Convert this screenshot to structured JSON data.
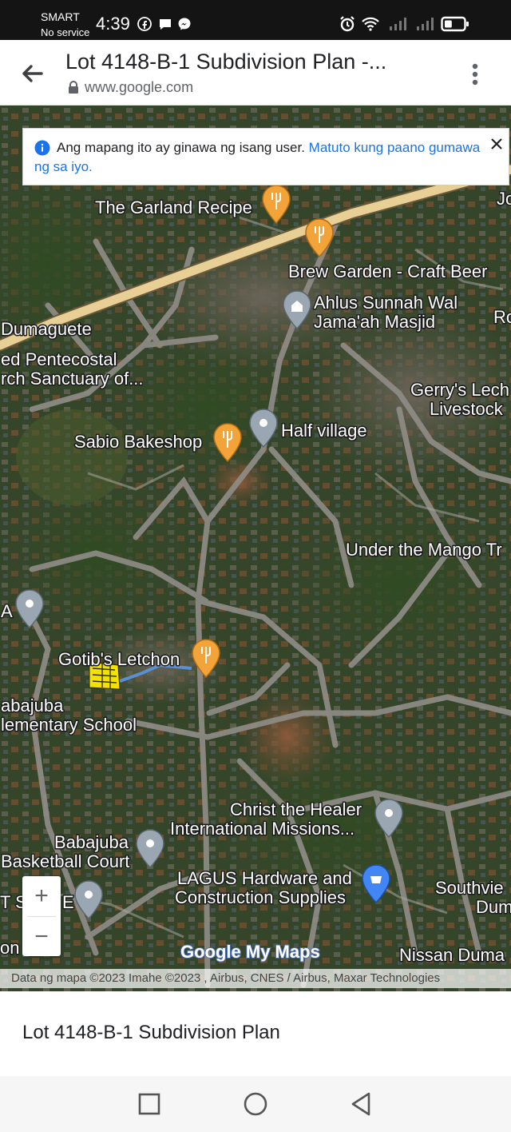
{
  "status_bar": {
    "carrier": "SMART",
    "service": "No service",
    "time": "4:39",
    "battery_level": 0.4
  },
  "header": {
    "title": "Lot 4148-B-1 Subdivision Plan -...",
    "url": "www.google.com"
  },
  "notice": {
    "text": "Ang mapang ito ay ginawa ng isang user.",
    "link": "Matuto kung paano gumawa ng sa iyo."
  },
  "map": {
    "labels": [
      "The Garland Recipe",
      "Brew Garden - Craft Beer",
      "Ahlus Sunnah Wal",
      "Jama'ah Masjid",
      "Dumaguete",
      "ed Pentecostal",
      "rch Sanctuary of...",
      "Gerry's Lech",
      "Livestock",
      "Sabio Bakeshop",
      "Half village",
      "Under the Mango Tr",
      "Gotib's Letchon",
      "abajuba",
      "lementary School",
      "Christ the Healer",
      "International Missions...",
      "Babajuba",
      "Basketball Court",
      "LAGUS Hardware and",
      "Construction Supplies",
      "Southvie",
      "Dum",
      "Nissan Duma",
      "Ro",
      "Jo",
      "A",
      "T S",
      "E",
      "on"
    ],
    "zoom_in": "+",
    "zoom_out": "−",
    "logo": "Google My Maps",
    "attribution": "Data ng mapa ©2023 Imahe ©2023 , Airbus, CNES / Airbus, Maxar Technologies"
  },
  "sheet": {
    "title": "Lot 4148-B-1 Subdivision Plan"
  },
  "colors": {
    "accent": "#1a73e8",
    "food_pin": "#f2a33a",
    "place_pin": "#9aa6b2",
    "shop_pin": "#4285f4",
    "road": "#8f8c86",
    "highway": "#e8cf95",
    "boundary": "#f5e100"
  }
}
